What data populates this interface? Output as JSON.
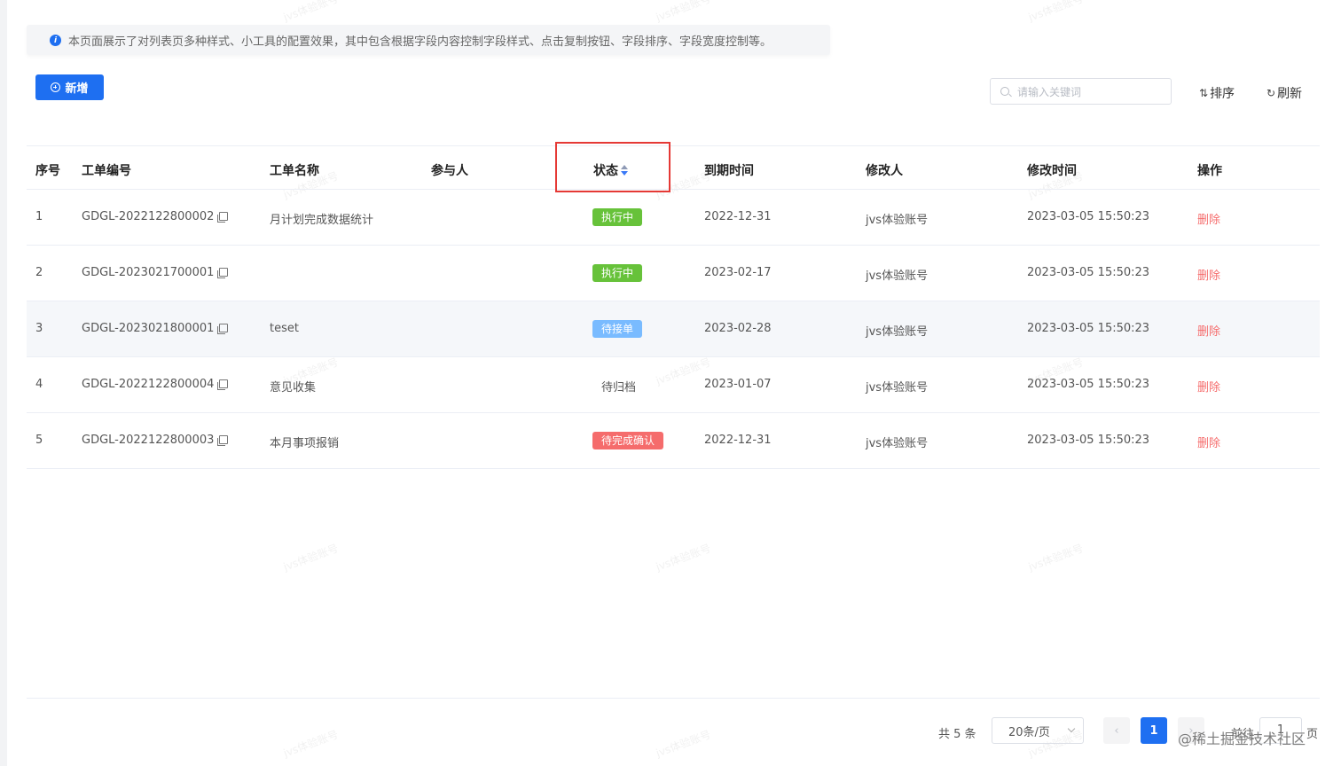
{
  "tip": {
    "text": "本页面展示了对列表页多种样式、小工具的配置效果，其中包含根据字段内容控制字段样式、点击复制按钮、字段排序、字段宽度控制等。"
  },
  "toolbar": {
    "add_label": "新增",
    "search_placeholder": "请输入关键词",
    "sort_label": "排序",
    "refresh_label": "刷新"
  },
  "table": {
    "headers": {
      "index": "序号",
      "code": "工单编号",
      "name": "工单名称",
      "participants": "参与人",
      "status": "状态",
      "due": "到期时间",
      "modifier": "修改人",
      "modified": "修改时间",
      "action": "操作"
    },
    "rows": [
      {
        "index": "1",
        "code": "GDGL-2022122800002",
        "name": "月计划完成数据统计",
        "participants": "",
        "status": "执行中",
        "status_color": "#67c23a",
        "due": "2022-12-31",
        "modifier": "jvs体验账号",
        "modified": "2023-03-05 15:50:23",
        "action": "删除"
      },
      {
        "index": "2",
        "code": "GDGL-2023021700001",
        "name": "",
        "participants": "",
        "status": "执行中",
        "status_color": "#67c23a",
        "due": "2023-02-17",
        "modifier": "jvs体验账号",
        "modified": "2023-03-05 15:50:23",
        "action": "删除"
      },
      {
        "index": "3",
        "code": "GDGL-2023021800001",
        "name": "teset",
        "participants": "",
        "status": "待接单",
        "status_color": "#79bbff",
        "due": "2023-02-28",
        "modifier": "jvs体验账号",
        "modified": "2023-03-05 15:50:23",
        "action": "删除"
      },
      {
        "index": "4",
        "code": "GDGL-2022122800004",
        "name": "意见收集",
        "participants": "",
        "status": "待归档",
        "status_color": "",
        "due": "2023-01-07",
        "modifier": "jvs体验账号",
        "modified": "2023-03-05 15:50:23",
        "action": "删除"
      },
      {
        "index": "5",
        "code": "GDGL-2022122800003",
        "name": "本月事项报销",
        "participants": "",
        "status": "待完成确认",
        "status_color": "#f56c6c",
        "due": "2022-12-31",
        "modifier": "jvs体验账号",
        "modified": "2023-03-05 15:50:23",
        "action": "删除"
      }
    ]
  },
  "pagination": {
    "total": "共 5 条",
    "page_size": "20条/页",
    "current": "1",
    "goto_label": "前往",
    "goto_value": "1",
    "page_unit": "页"
  },
  "watermark": "jvs体验账号",
  "credit": "@稀土掘金技术社区"
}
